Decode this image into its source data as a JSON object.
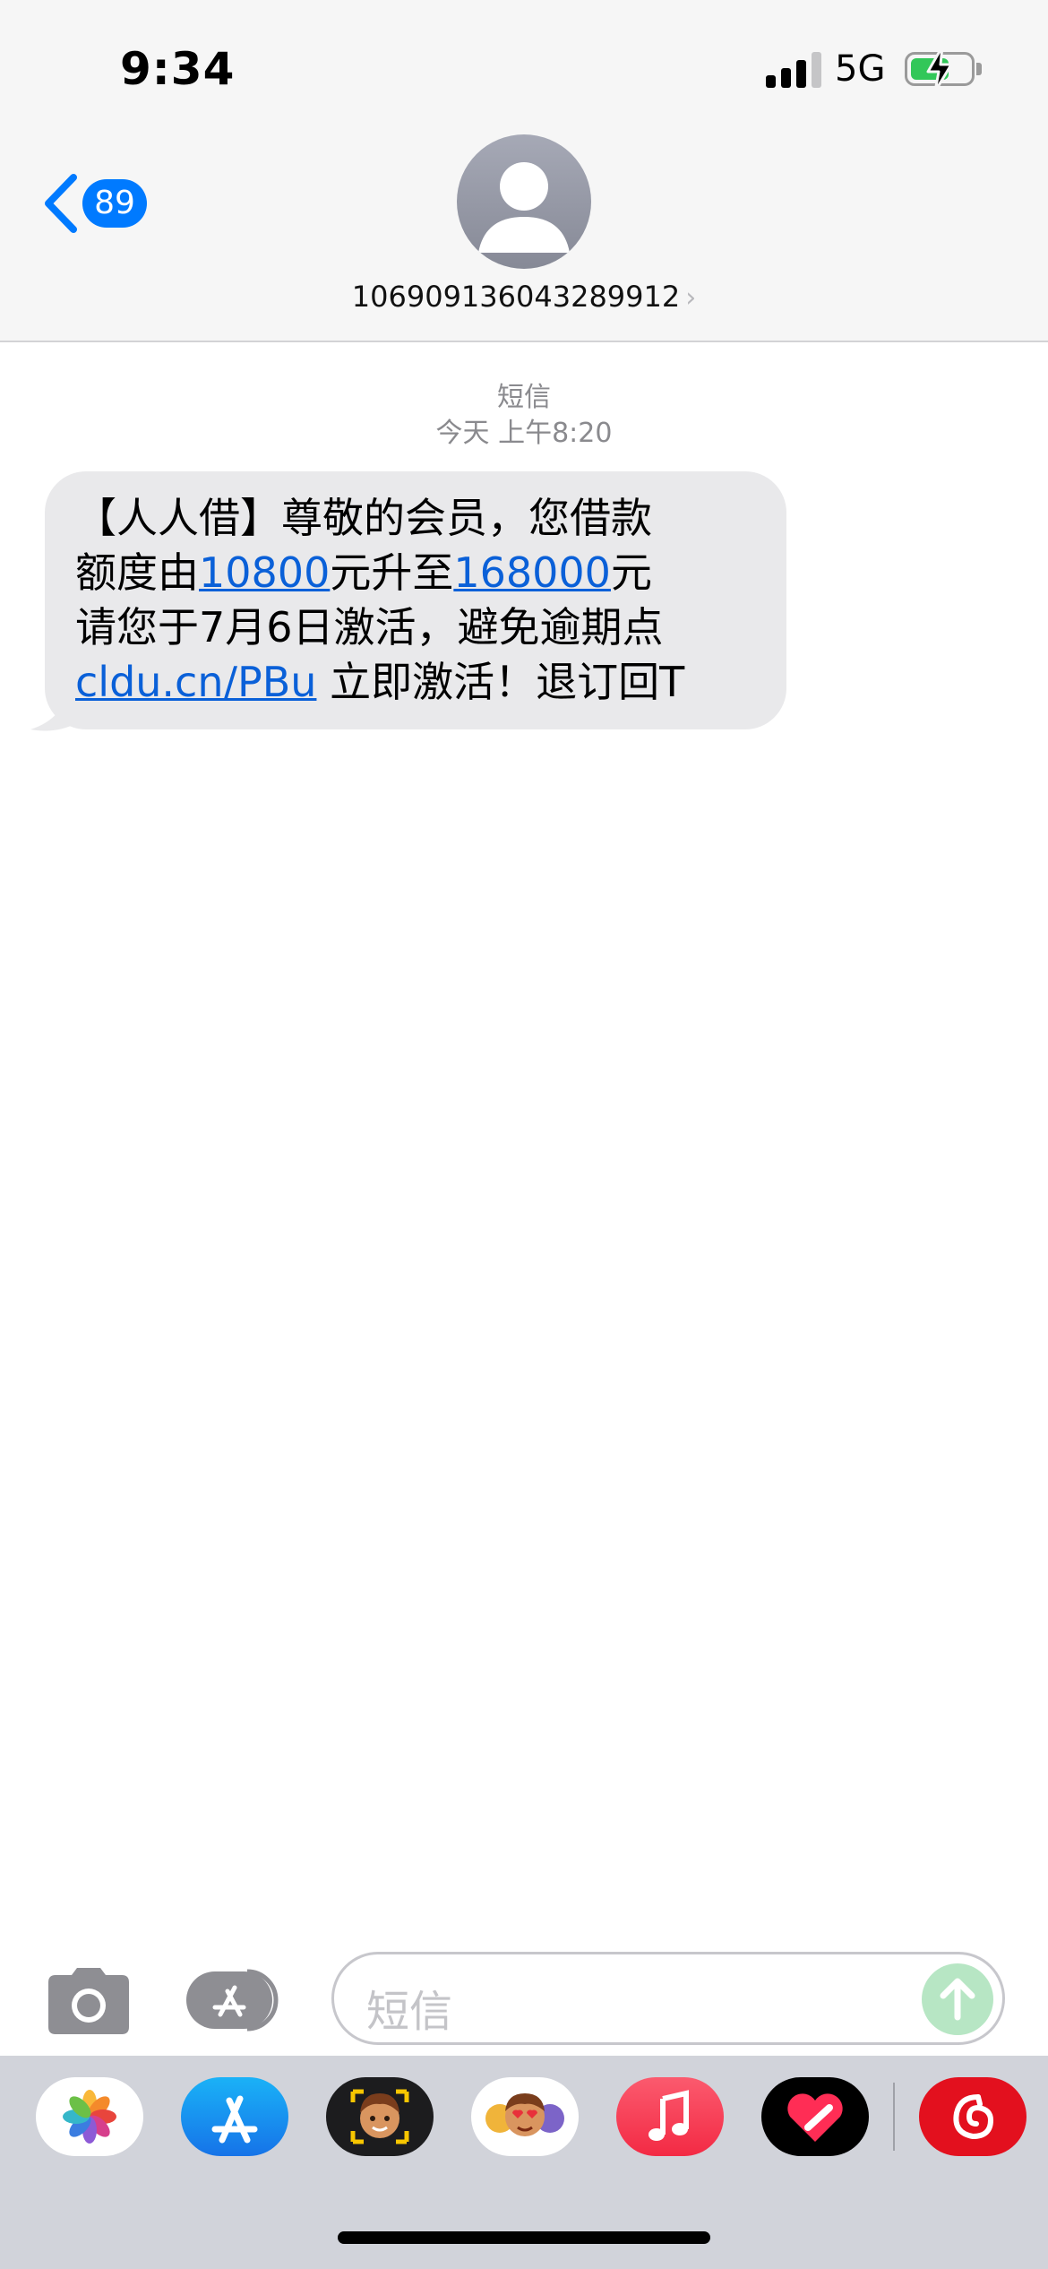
{
  "status_bar": {
    "time": "9:34",
    "network": "5G",
    "signal_bars": 3,
    "battery_charging": true,
    "battery_level": 0.55
  },
  "nav": {
    "back_badge": "89",
    "contact_number": "106909136043289912",
    "contact_chevron": "›"
  },
  "thread": {
    "service_label": "短信",
    "timestamp": "今天 上午8:20",
    "message": {
      "line1": "【人人借】尊敬的会员，您借款",
      "line2_a": "额度由",
      "link1": "10800",
      "line2_b": "元升至",
      "link2": "168000",
      "line2_c": "元",
      "line3": "请您于7月6日激活，避免逾期点",
      "link3": "cldu.cn/PBu",
      "line4_b": " 立即激活！退订回T"
    }
  },
  "composer": {
    "placeholder": "短信"
  },
  "app_strip": {
    "apps": [
      "photos-icon",
      "app-store-icon",
      "memoji-icon",
      "memoji-stickers-icon",
      "music-icon",
      "fitness-heart-icon",
      "netease-music-icon"
    ]
  },
  "colors": {
    "accent": "#007aff",
    "bubble": "#e9e9eb",
    "link": "#0a60d8",
    "send_disabled": "#b7e6c4"
  }
}
